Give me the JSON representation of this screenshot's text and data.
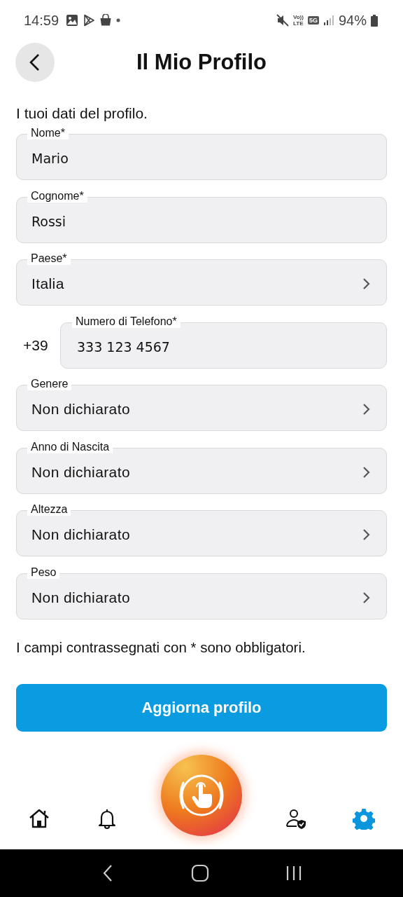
{
  "status_bar": {
    "time": "14:59",
    "volte_top": "Vo))",
    "volte_bottom": "LTE",
    "network": "5G",
    "battery": "94%"
  },
  "header": {
    "title": "Il Mio Profilo"
  },
  "intro": "I tuoi dati del profilo.",
  "fields": [
    {
      "kind": "text",
      "label": "Nome*",
      "value": "Mario"
    },
    {
      "kind": "text",
      "label": "Cognome*",
      "value": "Rossi"
    },
    {
      "kind": "select",
      "label": "Paese*",
      "value": "Italia"
    },
    {
      "kind": "phone",
      "label": "Numero di Telefono*",
      "prefix": "+39",
      "value": "333 123 4567"
    },
    {
      "kind": "select",
      "label": "Genere",
      "value": "Non dichiarato"
    },
    {
      "kind": "select",
      "label": "Anno di Nascita",
      "value": "Non dichiarato"
    },
    {
      "kind": "select",
      "label": "Altezza",
      "value": "Non dichiarato"
    },
    {
      "kind": "select",
      "label": "Peso",
      "value": "Non dichiarato"
    }
  ],
  "note": "I campi contrassegnati con * sono obbligatori.",
  "submit_button": "Aggiorna profilo",
  "nav": [
    {
      "kind": "home",
      "selected": false
    },
    {
      "kind": "bell",
      "selected": false
    },
    {
      "kind": "sos",
      "selected": false
    },
    {
      "kind": "profile",
      "selected": false
    },
    {
      "kind": "settings",
      "selected": true
    }
  ]
}
